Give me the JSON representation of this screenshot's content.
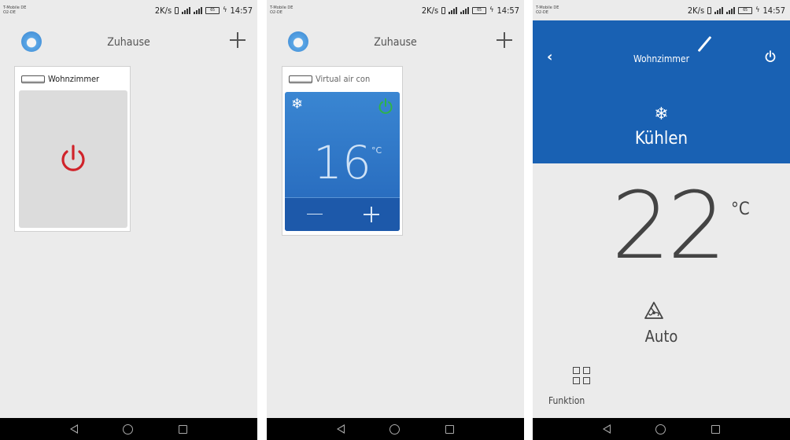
{
  "status": {
    "carrier_line1": "T-Mobile DE",
    "carrier_line2": "O2-DE",
    "speed": "2K/s",
    "battery": "65",
    "time": "14:57"
  },
  "screen1": {
    "title": "Zuhause",
    "device_label": "Wohnzimmer",
    "power_color": "#d0232a"
  },
  "screen2": {
    "title": "Zuhause",
    "device_label": "Virtual air con",
    "temperature": "16",
    "unit": "°C",
    "power_color": "#2eb34a"
  },
  "screen3": {
    "room": "Wohnzimmer",
    "mode_label": "Kühlen",
    "temperature": "22",
    "unit": "°C",
    "fan_label": "Auto",
    "function_label": "Funktion",
    "accent": "#1961b3"
  },
  "icons": {
    "snowflake": "❄",
    "back": "‹"
  }
}
